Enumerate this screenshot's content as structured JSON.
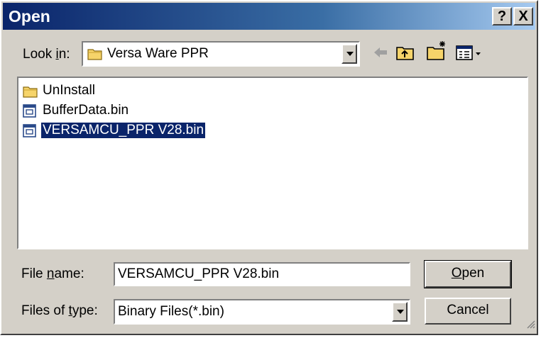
{
  "window": {
    "title": "Open",
    "help_label": "?",
    "close_label": "X"
  },
  "lookin": {
    "label_pre": "Look ",
    "label_key": "i",
    "label_post": "n:",
    "value": "Versa Ware PPR"
  },
  "toolbar": {
    "icons": [
      "back-arrow-icon",
      "up-folder-icon",
      "new-folder-icon",
      "view-menu-icon"
    ]
  },
  "files": [
    {
      "name": "UnInstall",
      "type": "folder",
      "selected": false
    },
    {
      "name": "BufferData.bin",
      "type": "file",
      "selected": false
    },
    {
      "name": "VERSAMCU_PPR V28.bin",
      "type": "file",
      "selected": true
    }
  ],
  "filename": {
    "label_pre": "File ",
    "label_key": "n",
    "label_post": "ame:",
    "value": "VERSAMCU_PPR V28.bin"
  },
  "filetype": {
    "label_pre": "Files of ",
    "label_key": "t",
    "label_post": "ype:",
    "value": "Binary Files(*.bin)"
  },
  "buttons": {
    "open_key": "O",
    "open_rest": "pen",
    "cancel": "Cancel"
  },
  "colors": {
    "selection": "#0a246a",
    "face": "#d4d0c8",
    "title_start": "#0a246a"
  }
}
